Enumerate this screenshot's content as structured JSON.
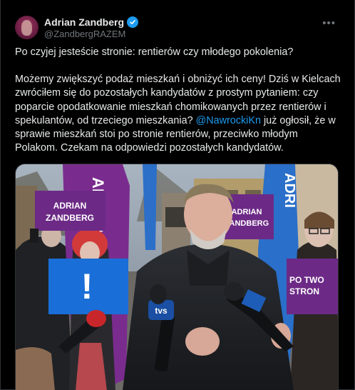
{
  "author": {
    "name": "Adrian Zandberg",
    "handle": "@ZandbergRAZEM",
    "verified": true
  },
  "tweet": {
    "paragraph1": "Po czyjej jesteście stronie: rentierów czy młodego pokolenia?",
    "paragraph2_before": "Możemy zwiększyć podaż mieszkań i obniżyć ich ceny! Dziś w Kielcach zwróciłem się do pozostałych kandydatów z prostym pytaniem: czy poparcie opodatkowanie mieszkań chomikowanych przez rentierów i spekulantów, od trzeciego mieszkania? ",
    "mention": "@NawrockiKn",
    "paragraph2_after": " już ogłosił, że w sprawie mieszkań stoi po stronie rentierów, przeciwko młodym Polakom. Czekam na odpowiedzi pozostałych kandydatów."
  },
  "photo": {
    "sign_left": [
      "ADRIAN",
      "ZANDBERG"
    ],
    "sign_right": [
      "ADRIAN",
      "ZANDBERG"
    ],
    "sign_far_right": [
      "PO TWO",
      "STRON"
    ],
    "banner_left": "ADRIAN",
    "banner_right": "ADRI",
    "mic_brand": "tvs",
    "exclamation": "!"
  },
  "colors": {
    "background": "#000000",
    "text": "#e7e9ea",
    "muted": "#71767b",
    "link": "#1d9bf0",
    "purple": "#6d2a8c",
    "blue": "#1b6fd8"
  }
}
